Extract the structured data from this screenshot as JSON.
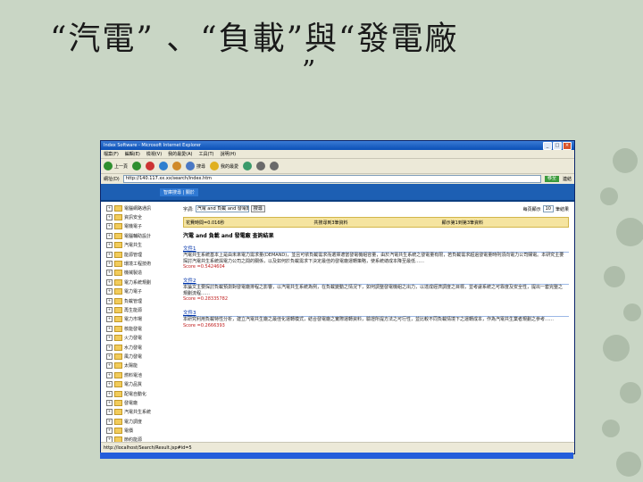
{
  "slide": {
    "title_line1": "“汽電” 、“負載”與“發電廠",
    "title_line2": "”"
  },
  "window": {
    "title": "Index Software - Microsoft Internet Explorer",
    "controls": [
      "_",
      "□",
      "×"
    ],
    "menu": [
      "檔案(F)",
      "編輯(E)",
      "檢視(V)",
      "我的最愛(A)",
      "工具(T)",
      "說明(H)"
    ],
    "toolbar": [
      {
        "label": "上一頁",
        "icon": "back-arrow-icon",
        "color": "#2f8f2f"
      },
      {
        "label": "",
        "icon": "forward-arrow-icon",
        "color": "#2f8f2f"
      },
      {
        "label": "",
        "icon": "stop-icon",
        "color": "#cc3333"
      },
      {
        "label": "",
        "icon": "refresh-icon",
        "color": "#2f7fcf"
      },
      {
        "label": "",
        "icon": "home-icon",
        "color": "#d08a2a"
      },
      {
        "label": "搜尋",
        "icon": "search-icon",
        "color": "#4a78c4"
      },
      {
        "label": "我的最愛",
        "icon": "favorites-icon",
        "color": "#e0b020"
      },
      {
        "label": "",
        "icon": "media-icon",
        "color": "#3a9a6a"
      },
      {
        "label": "",
        "icon": "mail-icon",
        "color": "#6a6a6a"
      },
      {
        "label": "",
        "icon": "print-icon",
        "color": "#6a6a6a"
      }
    ],
    "address_label": "網址(D)",
    "address": "http://140.117.xx.xx/search/index.htm",
    "go_label": "移至",
    "links_label": "連結",
    "status": "http://localhost/Search/Result.jsp#id=5"
  },
  "page": {
    "banner_link": "智庫搜尋 | 關於",
    "tree": [
      "電腦網路通訊",
      "資訊安全",
      "電機電子",
      "電腦輔助設計",
      "汽電共生",
      "能源管理",
      "環境工程技術",
      "機械製造",
      "電力系統規劃",
      "電力電子",
      "負載管理",
      "再生能源",
      "電力市場",
      "核能發電",
      "火力發電",
      "水力發電",
      "風力發電",
      "太陽能",
      "燃料電池",
      "電力品質",
      "配電自動化",
      "發電廠",
      "汽電共生系統",
      "電力調度",
      "電價",
      "節約能源",
      "電網",
      "智慧電網"
    ],
    "search_label": "字詞:",
    "search_value": "汽電 and 負載 and 發電廠",
    "search_button": "搜尋",
    "per_page_label": "每頁顯示",
    "per_page_value": "10",
    "per_page_unit": "筆結果",
    "stats": [
      "花費時間=0.016秒",
      "共搜尋到3筆資料",
      "顯示第1到第3筆資料"
    ],
    "result_title": "汽電 and 負載 and 發電廠 查詢結果",
    "results": [
      {
        "head": "文件1",
        "body": "汽電共生系統基本上是由未來電力需求量(DEMAND)，並且可依負載需求而選擇適當發電機組容量，由於汽電共生系統之發電量有限，若負載需求超過發電量時則須向電力公司購電。本研究主要探討汽電共生系統與電力公司之間的關係，以及如何於負載需求下決定最佳的發電廠運轉策略，使系統總成本降至最低……",
        "score": "Score =0.5424604"
      },
      {
        "head": "文件2",
        "body": "本論文主要探討負載預測對發電廠排程之影響，以汽電共生系統為例，在負載變動之情況下，如何調整發電機組之出力，以達成經濟調度之目標，並考慮系統之可靠度及安全性，提出一套完整之規劃流程……",
        "score": "Score =0.28335782"
      },
      {
        "head": "文件3",
        "body": "本研究利用負載特性分析，建立汽電共生廠之最佳化運轉模式，結合發電廠之實際運轉資料，驗證所提方法之可行性，並比較不同負載情境下之運轉成本，作為汽電共生業者規劃之參考……",
        "score": "Score =0.2666393"
      }
    ]
  }
}
